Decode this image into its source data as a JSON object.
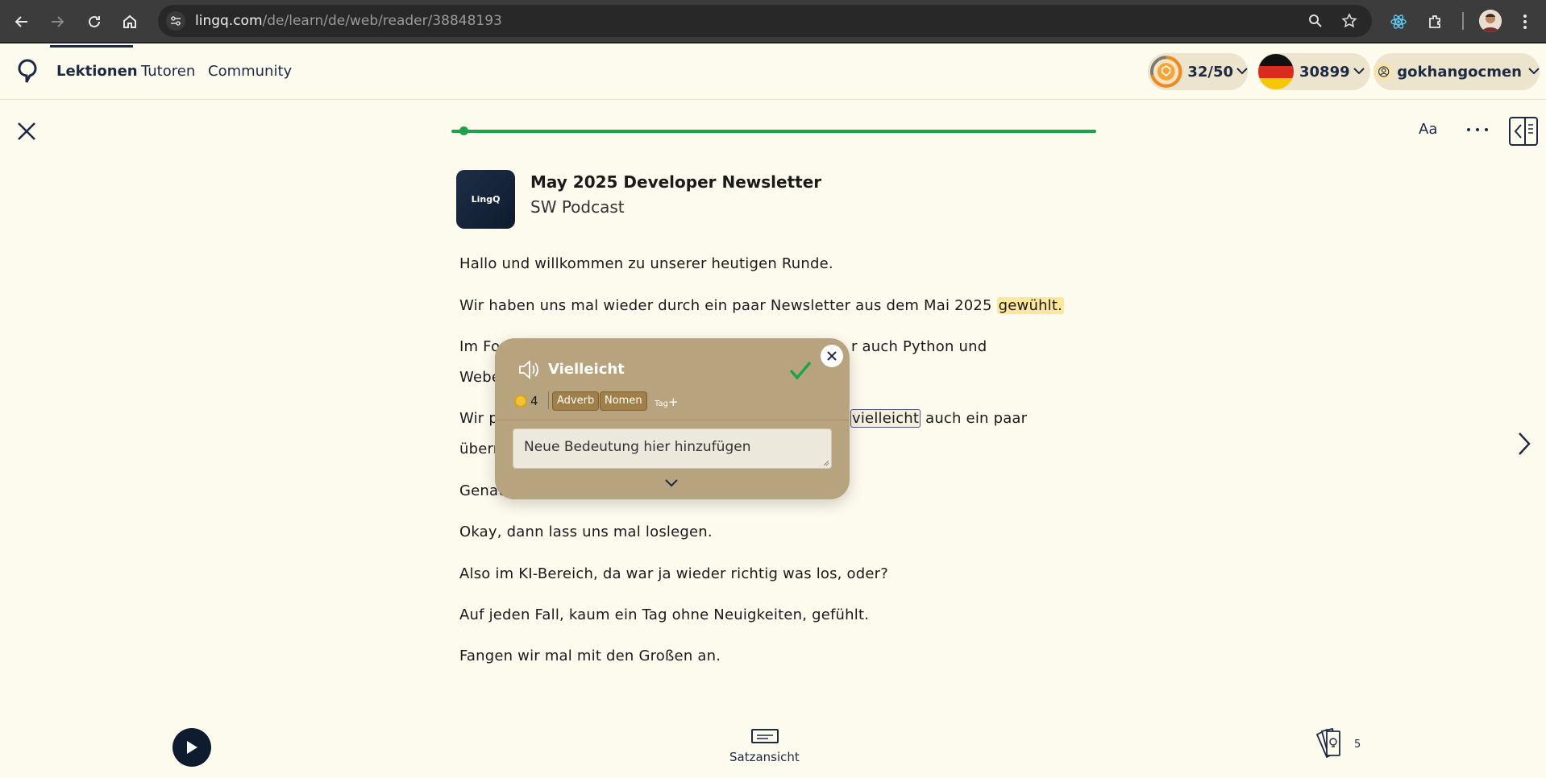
{
  "browser": {
    "url_host": "lingq.com",
    "url_path": "/de/learn/de/web/reader/38848193"
  },
  "nav": {
    "links": [
      "Lektionen",
      "Tutoren",
      "Community"
    ],
    "streak": "32/50",
    "known_words": "30899",
    "username": "gokhangocmen"
  },
  "lesson": {
    "title": "May 2025 Developer Newsletter",
    "subtitle": "SW Podcast",
    "thumb_text": "LingQ",
    "font_button": "Aa",
    "paragraphs": {
      "p1": "Hallo und willkommen zu unserer heutigen Runde.",
      "p2_text": "Wir haben uns mal wieder durch ein paar Newsletter aus dem Mai 2025 ",
      "p2_highlight": "gewühlt.",
      "p3_left": "Im Fo",
      "p3_right": "r auch Python und",
      "p4_left": "Webe",
      "p5_left": "Wir p",
      "p5_selected": "vielleicht",
      "p5_right": " auch ein paar",
      "p6_left": "überr",
      "p7_left": "Genau",
      "p8": "Okay, dann lass uns mal loslegen.",
      "p9": "Also im KI-Bereich, da war ja wieder richtig was los, oder?",
      "p10": "Auf jeden Fall, kaum ein Tag ohne Neuigkeiten, gefühlt.",
      "p11": "Fangen wir mal mit den Großen an."
    }
  },
  "popup": {
    "word": "Vielleicht",
    "coin_count": "4",
    "tags": [
      "Adverb",
      "Nomen"
    ],
    "tag_add": "Tag",
    "tag_plus": "+",
    "meaning_placeholder": "Neue Bedeutung hier hinzufügen"
  },
  "bottom": {
    "sentence_view_label": "Satzansicht",
    "cards_count": "5"
  },
  "colors": {
    "page_bg": "#fdfaee",
    "navy": "#1d2a44",
    "progress_green": "#1ca34a",
    "popup_bg": "#b7a37e",
    "tag_bg": "#a08048",
    "highlight_yellow": "#fde79a"
  }
}
